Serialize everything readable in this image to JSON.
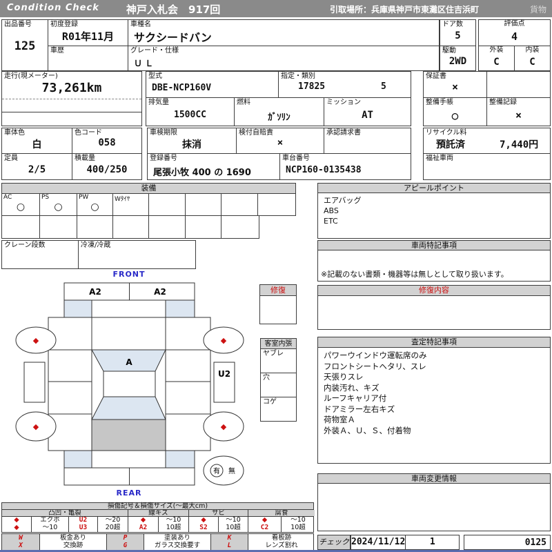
{
  "colors": {
    "accent_red": "#cc1111",
    "accent_blue": "#2929c8",
    "header_gray": "#8a8a8a",
    "bar_gray": "#d2d2d2",
    "glass_blue": "#dce6f1",
    "cargo_gray": "#c6c6c6"
  },
  "header": {
    "brand": "Condition Check",
    "auction": "神戸入札会　917回",
    "pickup": "引取場所：兵庫県神戸市東灘区住吉浜町",
    "category": "貨物"
  },
  "info": {
    "lot_l": "出品番号",
    "lot_v": "125",
    "reg_l": "初度登録",
    "reg_v": "R01年11月",
    "history_l": "車歴",
    "history_v": "",
    "name_l": "車種名",
    "name_v": "サクシードバン",
    "grade_l": "グレード・仕様",
    "grade_v": "Ｕ Ｌ",
    "doors_l": "ドア数",
    "doors_v": "5",
    "drive_l": "駆動",
    "drive_v": "2WD",
    "score_l": "評価点",
    "score_v": "4",
    "ext_l": "外装",
    "ext_v": "C",
    "int_l": "内装",
    "int_v": "C",
    "mileage_l": "走行(現メーター)",
    "mileage_v": "73,261km",
    "model_l": "型式",
    "model_v": "DBE-NCP160V",
    "desig_l": "指定・類別",
    "desig_v1": "17825",
    "desig_v2": "5",
    "disp_l": "排気量",
    "disp_v": "1500CC",
    "fuel_l": "燃料",
    "fuel_v": "ｶﾞｿﾘﾝ",
    "mission_l": "ミッション",
    "mission_v": "AT",
    "warranty_l": "保証書",
    "warranty_v": "×",
    "book_l": "整備手帳",
    "book_v": "○",
    "record_l": "整備記録",
    "record_v": "×",
    "color_l": "車体色",
    "color_v": "白",
    "ccode_l": "色コード",
    "ccode_v": "058",
    "shaken_l": "車検期限",
    "shaken_v": "抹消",
    "jibai_l": "検付自賠責",
    "jibai_v": "×",
    "approval_l": "承認請求書",
    "approval_v": "",
    "recycle_l": "リサイクル料",
    "recycle_status": "預託済",
    "recycle_fee": "7,440円",
    "capacity_l": "定員",
    "capacity_v": "2/5",
    "load_l": "積載量",
    "load_v": "400/250",
    "regno_l": "登録番号",
    "regno_v": "尾張小牧 400 の 1690",
    "chassis_l": "車台番号",
    "chassis_v": "NCP160-0135438",
    "welfare_l": "福祉車両",
    "welfare_v": ""
  },
  "equipment": {
    "title": "装備",
    "row1": [
      {
        "label": "AC",
        "value": "○"
      },
      {
        "label": "PS",
        "value": "○"
      },
      {
        "label": "PW",
        "value": "○"
      },
      {
        "label": "Wﾀｲﾔ",
        "value": ""
      }
    ],
    "crane_label": "クレーン段数",
    "freezer_label": "冷凍/冷蔵"
  },
  "diagram": {
    "front": "FRONT",
    "rear": "REAR",
    "hood_left": "A2",
    "hood_right": "A2",
    "roof": "A",
    "rocker_right": "U2",
    "wheel_mark": "◆",
    "repair_title": "修復",
    "interior_title": "客室内張",
    "interior_rows": [
      "ヤブレ",
      "穴",
      "コゲ"
    ],
    "presence_yes": "有",
    "presence_no": "無"
  },
  "panels": {
    "appeal": {
      "title": "アピールポイント",
      "lines": [
        "エアバッグ",
        "ABS",
        "ETC"
      ]
    },
    "vehicle_notes": {
      "title": "車両特記事項",
      "note": "※記載のない書類・機器等は無しとして取り扱います。"
    },
    "repair": {
      "title": "修復内容"
    },
    "assessment": {
      "title": "査定特記事項",
      "lines": [
        "パワーウインドウ運転席のみ",
        "フロントシートヘタリ、スレ",
        "天張りスレ",
        "内装汚れ、キズ",
        "ルーフキャリア付",
        "ドアミラー左右キズ",
        "荷物室Ａ",
        "外装Ａ、Ｕ、Ｓ、付着物"
      ]
    },
    "change": {
      "title": "車両変更情報"
    }
  },
  "legend": {
    "title": "損傷記号＆損傷サイズ(～最大cm)",
    "categories": [
      "凸凹・亀裂",
      "線キズ",
      "サビ",
      "腐食"
    ],
    "rowA": [
      "◆",
      "エクボ",
      "U2",
      "～20",
      "◆",
      "～10",
      "◆",
      "～10",
      "◆",
      "～10"
    ],
    "rowB": [
      "◆",
      "～10",
      "U3",
      "20超",
      "A2",
      "10超",
      "S2",
      "10超",
      "C2",
      "10超"
    ],
    "codesA": [
      {
        "code": "W",
        "label": "板金あり"
      },
      {
        "code": "P",
        "label": "塗装あり"
      },
      {
        "code": "K",
        "label": "看板跡"
      }
    ],
    "codesB": [
      {
        "code": "X",
        "label": "交換跡"
      },
      {
        "code": "G",
        "label": "ガラス交換要す"
      },
      {
        "code": "L",
        "label": "レンズ割れ"
      }
    ]
  },
  "check": {
    "label": "チェック",
    "date": "2024/11/12",
    "count": "1",
    "number": "0125"
  }
}
